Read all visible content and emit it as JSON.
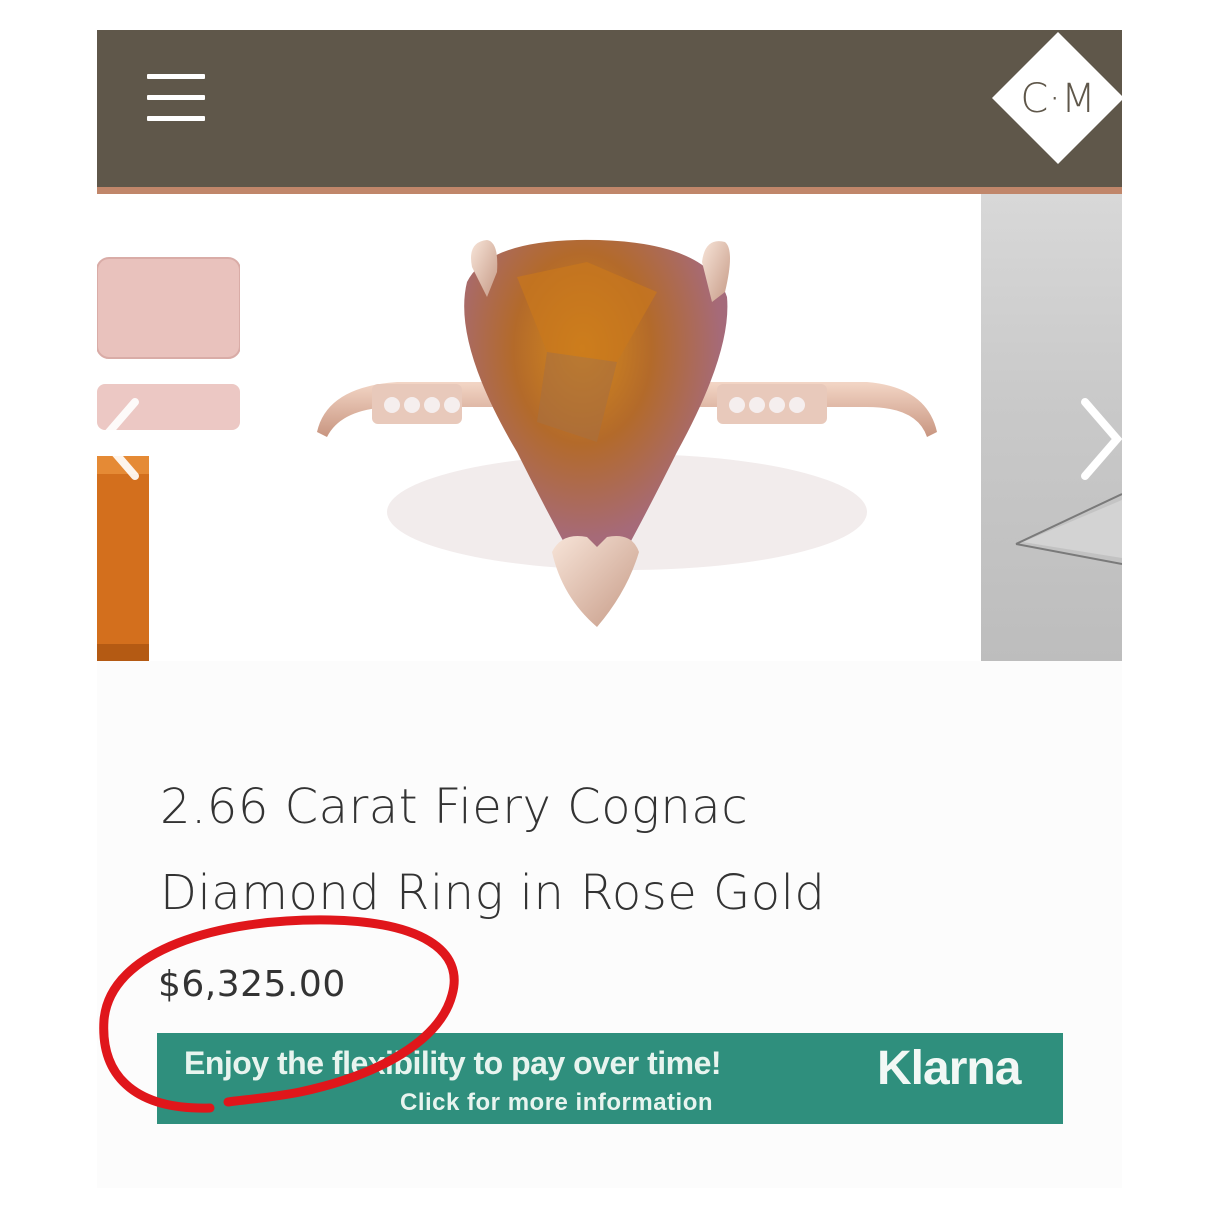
{
  "header": {
    "menu_icon": "hamburger-menu-icon",
    "logo_text": "C·M",
    "background": "#5f574a",
    "accent": "#c0866a"
  },
  "gallery": {
    "prev_icon": "chevron-left-icon",
    "next_icon": "chevron-right-icon"
  },
  "product": {
    "title_line1": "2.66 Carat Fiery Cognac",
    "title_line2": "Diamond Ring in Rose Gold",
    "price": "$6,325.00"
  },
  "klarna_banner": {
    "line1": "Enjoy the flexibility to pay over time!",
    "line2": "Click for more information",
    "brand": "Klarna",
    "background": "#2f8f7d"
  },
  "annotation_color": "#e0161b"
}
